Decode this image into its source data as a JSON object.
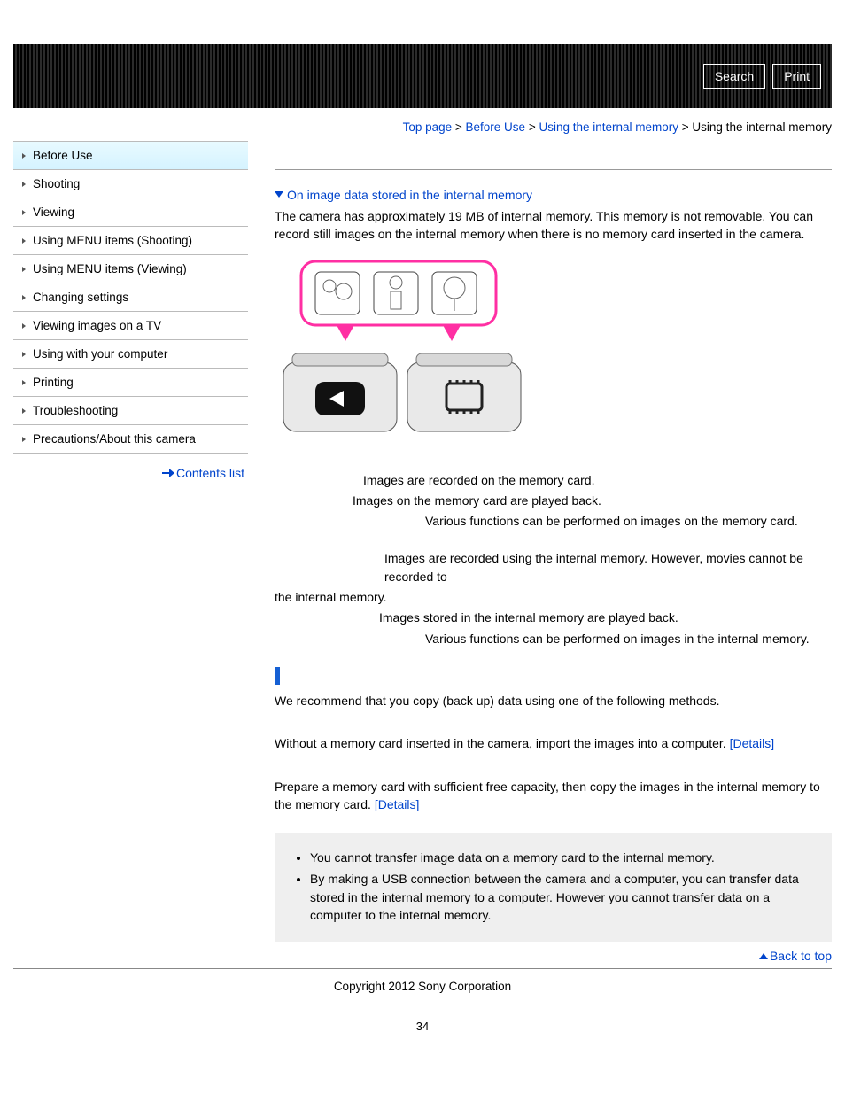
{
  "banner": {
    "search_label": "Search",
    "print_label": "Print"
  },
  "breadcrumb": {
    "items": [
      "Top page",
      "Before Use",
      "Using the internal memory"
    ],
    "sep": " > ",
    "current": "Using the internal memory"
  },
  "sidebar": {
    "items": [
      {
        "label": "Before Use",
        "active": true
      },
      {
        "label": "Shooting"
      },
      {
        "label": "Viewing"
      },
      {
        "label": "Using MENU items (Shooting)"
      },
      {
        "label": "Using MENU items (Viewing)"
      },
      {
        "label": "Changing settings"
      },
      {
        "label": "Viewing images on a TV"
      },
      {
        "label": "Using with your computer"
      },
      {
        "label": "Printing"
      },
      {
        "label": "Troubleshooting"
      },
      {
        "label": "Precautions/About this camera"
      }
    ],
    "contents_list": "Contents list"
  },
  "main": {
    "anchor": "On image data stored in the internal memory",
    "intro": "The camera has approximately 19 MB of internal memory. This memory is not removable. You can record still images on the internal memory when there is no memory card inserted in the camera.",
    "block1": {
      "l1": "Images are recorded on the memory card.",
      "l2": "Images on the memory card are played back.",
      "l3": "Various functions can be performed on images on the memory card."
    },
    "block2": {
      "l1": "Images are recorded using the internal memory. However, movies cannot be recorded to the internal memory.",
      "l1_pre": "Images are recorded using the internal memory. However, movies cannot be recorded to",
      "l1_wrap": "the internal memory.",
      "l2": "Images stored in the internal memory are played back.",
      "l3": "Various functions can be performed on images in the internal memory."
    },
    "recommend": "We recommend that you copy (back up) data using one of the following methods.",
    "method1_text": "Without a memory card inserted in the camera, import the images into a computer. ",
    "method2_text": "Prepare a memory card with sufficient free capacity, then copy the images in the internal memory to the memory card. ",
    "details_label": "[Details]",
    "notes": [
      "You cannot transfer image data on a memory card to the internal memory.",
      "By making a USB connection between the camera and a computer, you can transfer data stored in the internal memory to a computer. However you cannot transfer data on a computer to the internal memory."
    ],
    "back_to_top": "Back to top"
  },
  "footer": {
    "copyright": "Copyright 2012 Sony Corporation",
    "page_number": "34"
  }
}
